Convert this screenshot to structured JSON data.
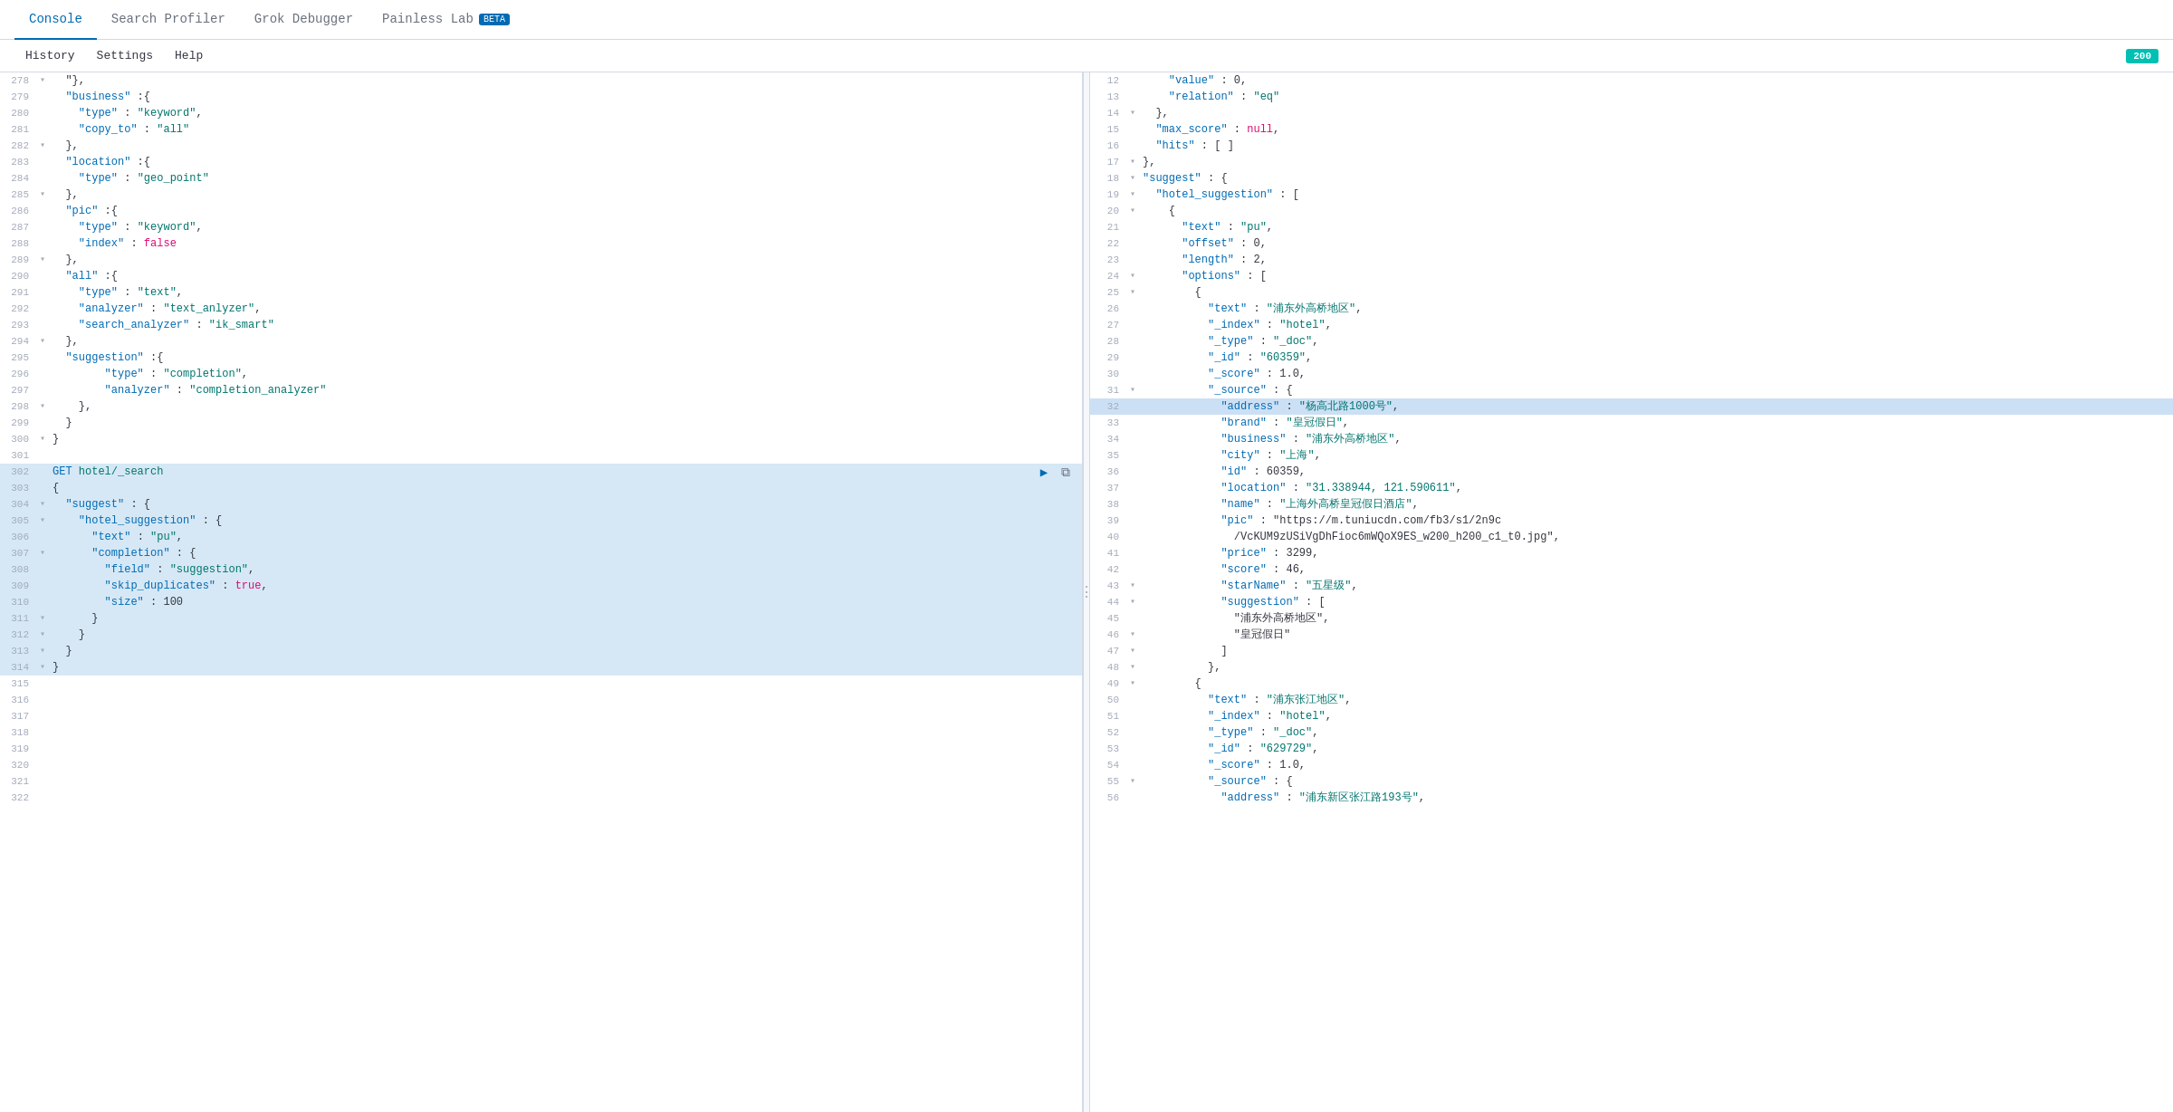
{
  "nav": {
    "tabs": [
      {
        "label": "Console",
        "active": true
      },
      {
        "label": "Search Profiler",
        "active": false
      },
      {
        "label": "Grok Debugger",
        "active": false
      },
      {
        "label": "Painless Lab",
        "active": false,
        "badge": "BETA"
      }
    ]
  },
  "subnav": {
    "items": [
      {
        "label": "History"
      },
      {
        "label": "Settings"
      },
      {
        "label": "Help"
      }
    ]
  },
  "status": "200",
  "editor": {
    "lines": [
      {
        "num": 278,
        "fold": "▾",
        "content": "  \"},",
        "indent": 0
      },
      {
        "num": 279,
        "fold": "",
        "content": "  \"business\":{",
        "indent": 0
      },
      {
        "num": 280,
        "fold": "",
        "content": "    \"type\": \"keyword\",",
        "indent": 0
      },
      {
        "num": 281,
        "fold": "",
        "content": "    \"copy_to\": \"all\"",
        "indent": 0
      },
      {
        "num": 282,
        "fold": "▾",
        "content": "  },",
        "indent": 0
      },
      {
        "num": 283,
        "fold": "",
        "content": "  \"location\":{",
        "indent": 0
      },
      {
        "num": 284,
        "fold": "",
        "content": "    \"type\": \"geo_point\"",
        "indent": 0
      },
      {
        "num": 285,
        "fold": "▾",
        "content": "  },",
        "indent": 0
      },
      {
        "num": 286,
        "fold": "",
        "content": "  \"pic\":{",
        "indent": 0
      },
      {
        "num": 287,
        "fold": "",
        "content": "    \"type\": \"keyword\",",
        "indent": 0
      },
      {
        "num": 288,
        "fold": "",
        "content": "    \"index\": false",
        "indent": 0
      },
      {
        "num": 289,
        "fold": "▾",
        "content": "  },",
        "indent": 0
      },
      {
        "num": 290,
        "fold": "",
        "content": "  \"all\":{",
        "indent": 0
      },
      {
        "num": 291,
        "fold": "",
        "content": "    \"type\": \"text\",",
        "indent": 0
      },
      {
        "num": 292,
        "fold": "",
        "content": "    \"analyzer\": \"text_anlyzer\",",
        "indent": 0
      },
      {
        "num": 293,
        "fold": "",
        "content": "    \"search_analyzer\": \"ik_smart\"",
        "indent": 0
      },
      {
        "num": 294,
        "fold": "▾",
        "content": "  },",
        "indent": 0
      },
      {
        "num": 295,
        "fold": "",
        "content": "  \"suggestion\":{",
        "indent": 0
      },
      {
        "num": 296,
        "fold": "",
        "content": "        \"type\": \"completion\",",
        "indent": 0
      },
      {
        "num": 297,
        "fold": "",
        "content": "        \"analyzer\": \"completion_analyzer\"",
        "indent": 0
      },
      {
        "num": 298,
        "fold": "▾",
        "content": "    },",
        "indent": 0
      },
      {
        "num": 299,
        "fold": "",
        "content": "  }",
        "indent": 0
      },
      {
        "num": 300,
        "fold": "▾",
        "content": "}",
        "indent": 0
      },
      {
        "num": 301,
        "fold": "",
        "content": "",
        "indent": 0
      },
      {
        "num": 302,
        "fold": "",
        "content": "GET hotel/_search",
        "indent": 0,
        "request": true
      },
      {
        "num": 303,
        "fold": "",
        "content": "{",
        "indent": 0,
        "selected": true
      },
      {
        "num": 304,
        "fold": "▾",
        "content": "  \"suggest\": {",
        "indent": 0,
        "selected": true
      },
      {
        "num": 305,
        "fold": "▾",
        "content": "    \"hotel_suggestion\": {",
        "indent": 0,
        "selected": true
      },
      {
        "num": 306,
        "fold": "",
        "content": "      \"text\": \"pu\",",
        "indent": 0,
        "selected": true
      },
      {
        "num": 307,
        "fold": "▾",
        "content": "      \"completion\": {",
        "indent": 0,
        "selected": true
      },
      {
        "num": 308,
        "fold": "",
        "content": "        \"field\": \"suggestion\",",
        "indent": 0,
        "selected": true
      },
      {
        "num": 309,
        "fold": "",
        "content": "        \"skip_duplicates\": true,",
        "indent": 0,
        "selected": true
      },
      {
        "num": 310,
        "fold": "",
        "content": "        \"size\": 100",
        "indent": 0,
        "selected": true
      },
      {
        "num": 311,
        "fold": "▾",
        "content": "      }",
        "indent": 0,
        "selected": true
      },
      {
        "num": 312,
        "fold": "▾",
        "content": "    }",
        "indent": 0,
        "selected": true
      },
      {
        "num": 313,
        "fold": "▾",
        "content": "  }",
        "indent": 0,
        "selected": true
      },
      {
        "num": 314,
        "fold": "▾",
        "content": "}",
        "indent": 0,
        "selected": true
      },
      {
        "num": 315,
        "fold": "",
        "content": "",
        "indent": 0
      },
      {
        "num": 316,
        "fold": "",
        "content": "",
        "indent": 0
      },
      {
        "num": 317,
        "fold": "",
        "content": "",
        "indent": 0
      },
      {
        "num": 318,
        "fold": "",
        "content": "",
        "indent": 0
      },
      {
        "num": 319,
        "fold": "",
        "content": "",
        "indent": 0
      },
      {
        "num": 320,
        "fold": "",
        "content": "",
        "indent": 0
      },
      {
        "num": 321,
        "fold": "",
        "content": "",
        "indent": 0
      },
      {
        "num": 322,
        "fold": "",
        "content": "",
        "indent": 0
      }
    ]
  },
  "output": {
    "lines": [
      {
        "num": 12,
        "fold": "",
        "content": "    \"value\" : 0,"
      },
      {
        "num": 13,
        "fold": "",
        "content": "    \"relation\" : \"eq\""
      },
      {
        "num": 14,
        "fold": "▾",
        "content": "  },"
      },
      {
        "num": 15,
        "fold": "",
        "content": "  \"max_score\" : null,"
      },
      {
        "num": 16,
        "fold": "",
        "content": "  \"hits\" : [ ]"
      },
      {
        "num": 17,
        "fold": "▾",
        "content": "},"
      },
      {
        "num": 18,
        "fold": "▾",
        "content": "\"suggest\" : {"
      },
      {
        "num": 19,
        "fold": "▾",
        "content": "  \"hotel_suggestion\" : ["
      },
      {
        "num": 20,
        "fold": "▾",
        "content": "    {"
      },
      {
        "num": 21,
        "fold": "",
        "content": "      \"text\" : \"pu\","
      },
      {
        "num": 22,
        "fold": "",
        "content": "      \"offset\" : 0,"
      },
      {
        "num": 23,
        "fold": "",
        "content": "      \"length\" : 2,"
      },
      {
        "num": 24,
        "fold": "▾",
        "content": "      \"options\" : ["
      },
      {
        "num": 25,
        "fold": "▾",
        "content": "        {"
      },
      {
        "num": 26,
        "fold": "",
        "content": "          \"text\" : \"浦东外高桥地区\","
      },
      {
        "num": 27,
        "fold": "",
        "content": "          \"_index\" : \"hotel\","
      },
      {
        "num": 28,
        "fold": "",
        "content": "          \"_type\" : \"_doc\","
      },
      {
        "num": 29,
        "fold": "",
        "content": "          \"_id\" : \"60359\","
      },
      {
        "num": 30,
        "fold": "",
        "content": "          \"_score\" : 1.0,"
      },
      {
        "num": 31,
        "fold": "▾",
        "content": "          \"_source\" : {"
      },
      {
        "num": 32,
        "fold": "",
        "content": "            \"address\" : \"杨高北路1000号\",",
        "highlight": true
      },
      {
        "num": 33,
        "fold": "",
        "content": "            \"brand\" : \"皇冠假日\","
      },
      {
        "num": 34,
        "fold": "",
        "content": "            \"business\" : \"浦东外高桥地区\","
      },
      {
        "num": 35,
        "fold": "",
        "content": "            \"city\" : \"上海\","
      },
      {
        "num": 36,
        "fold": "",
        "content": "            \"id\" : 60359,"
      },
      {
        "num": 37,
        "fold": "",
        "content": "            \"location\" : \"31.338944, 121.590611\","
      },
      {
        "num": 38,
        "fold": "",
        "content": "            \"name\" : \"上海外高桥皇冠假日酒店\","
      },
      {
        "num": 39,
        "fold": "",
        "content": "            \"pic\" : \"https://m.tuniucdn.com/fb3/s1/2n9c"
      },
      {
        "num": 40,
        "fold": "",
        "content": "              /VcKUM9zUSiVgDhFioc6mWQoX9ES_w200_h200_c1_t0.jpg\","
      },
      {
        "num": 41,
        "fold": "",
        "content": "            \"price\" : 3299,"
      },
      {
        "num": 42,
        "fold": "",
        "content": "            \"score\" : 46,"
      },
      {
        "num": 43,
        "fold": "▾",
        "content": "            \"starName\" : \"五星级\","
      },
      {
        "num": 44,
        "fold": "▾",
        "content": "            \"suggestion\" : ["
      },
      {
        "num": 45,
        "fold": "",
        "content": "              \"浦东外高桥地区\","
      },
      {
        "num": 46,
        "fold": "▾",
        "content": "              \"皇冠假日\""
      },
      {
        "num": 47,
        "fold": "▾",
        "content": "            ]"
      },
      {
        "num": 48,
        "fold": "▾",
        "content": "          },"
      },
      {
        "num": 49,
        "fold": "▾",
        "content": "        {"
      },
      {
        "num": 50,
        "fold": "",
        "content": "          \"text\" : \"浦东张江地区\","
      },
      {
        "num": 51,
        "fold": "",
        "content": "          \"_index\" : \"hotel\","
      },
      {
        "num": 52,
        "fold": "",
        "content": "          \"_type\" : \"_doc\","
      },
      {
        "num": 53,
        "fold": "",
        "content": "          \"_id\" : \"629729\","
      },
      {
        "num": 54,
        "fold": "",
        "content": "          \"_score\" : 1.0,"
      },
      {
        "num": 55,
        "fold": "▾",
        "content": "          \"_source\" : {"
      },
      {
        "num": 56,
        "fold": "",
        "content": "            \"address\" : \"浦东新区张江路193号\","
      }
    ]
  }
}
